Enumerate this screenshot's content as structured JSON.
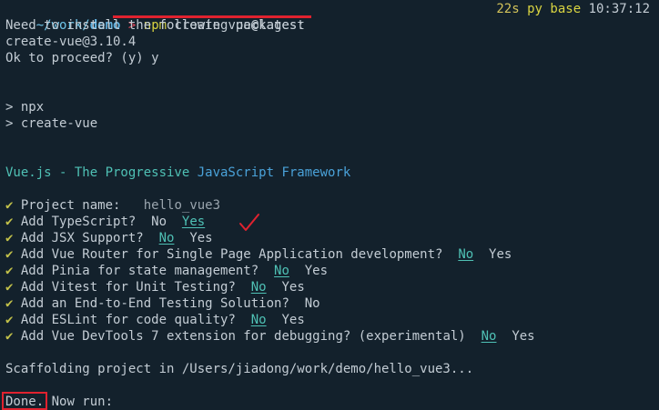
{
  "prompt": {
    "path_prefix": "~/work/",
    "dir": "demo",
    "arrow": ">",
    "command_npm": "npm",
    "command_rest": " create vue@latest"
  },
  "status": {
    "duration": "22s",
    "py": "py",
    "env": "base",
    "time": "10:37:12"
  },
  "output": {
    "install_msg": "Need to install the following packages:",
    "package": "create-vue@3.10.4",
    "proceed": "Ok to proceed? (y) y",
    "npx": "> npx",
    "create_vue": "> create-vue",
    "banner": {
      "vuejs": "Vue.js - The Progressive ",
      "js": "JavaScript",
      "framework": " Framework"
    },
    "check_mark": "✔",
    "questions": [
      {
        "q": "Project name:",
        "sep": "   ",
        "answer": "hello_vue3",
        "other": ""
      },
      {
        "q": "Add TypeScript?",
        "sep": "  ",
        "answer": "No",
        "other": "Yes",
        "selected": "other"
      },
      {
        "q": "Add JSX Support?",
        "sep": "  ",
        "answer": "No",
        "other": "Yes",
        "selected": "answer"
      },
      {
        "q": "Add Vue Router for Single Page Application development?",
        "sep": "  ",
        "answer": "No",
        "other": "Yes",
        "selected": "answer"
      },
      {
        "q": "Add Pinia for state management?",
        "sep": "  ",
        "answer": "No",
        "other": "Yes",
        "selected": "answer"
      },
      {
        "q": "Add Vitest for Unit Testing?",
        "sep": "  ",
        "answer": "No",
        "other": "Yes",
        "selected": "answer"
      },
      {
        "q": "Add an End-to-End Testing Solution?",
        "sep": "  ",
        "answer": "No",
        "other": "",
        "selected": "none"
      },
      {
        "q": "Add ESLint for code quality?",
        "sep": "  ",
        "answer": "No",
        "other": "Yes",
        "selected": "answer"
      },
      {
        "q": "Add Vue DevTools 7 extension for debugging? (experimental)",
        "sep": "  ",
        "answer": "No",
        "other": "Yes",
        "selected": "answer"
      }
    ],
    "scaffolding": "Scaffolding project in /Users/jiadong/work/demo/hello_vue3...",
    "done": "Done.",
    "now_run": " Now run:"
  },
  "colors": {
    "background": "#13212c",
    "annotation_red": "#e0222f",
    "choice_teal": "#4fc1b5"
  }
}
